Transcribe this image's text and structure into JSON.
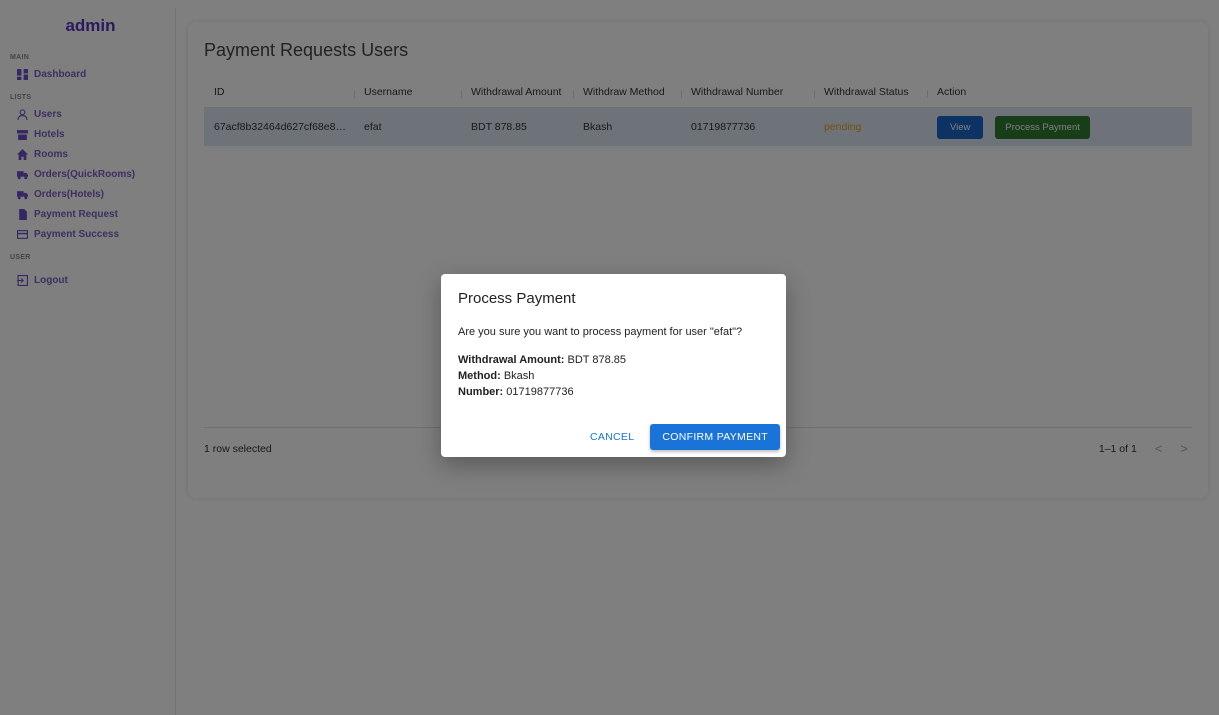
{
  "sidebar": {
    "brand": "admin",
    "sections": {
      "main": "MAIN",
      "lists": "LISTS",
      "user": "USER"
    },
    "items": {
      "dashboard": "Dashboard",
      "users": "Users",
      "hotels": "Hotels",
      "rooms": "Rooms",
      "orders_quickrooms": "Orders(QuickRooms)",
      "orders_hotels": "Orders(Hotels)",
      "payment_request": "Payment Request",
      "payment_success": "Payment Success",
      "logout": "Logout"
    }
  },
  "main": {
    "title": "Payment Requests Users",
    "columns": [
      "ID",
      "Username",
      "Withdrawal Amount",
      "Withdraw Method",
      "Withdrawal Number",
      "Withdrawal Status",
      "Action",
      ""
    ],
    "rows": [
      {
        "id": "67acf8b32464d627cf68e8…",
        "username": "efat",
        "amount": "BDT 878.85",
        "method": "Bkash",
        "number": "01719877736",
        "status": "pending",
        "view_label": "View",
        "process_label": "Process Payment"
      }
    ],
    "footer": {
      "selected": "1 row selected",
      "range": "1–1 of 1",
      "prev": "<",
      "next": ">"
    }
  },
  "dialog": {
    "title": "Process Payment",
    "message": "Are you sure you want to process payment for user \"efat\"?",
    "amount_label": "Withdrawal Amount:",
    "amount_value": "BDT 878.85",
    "method_label": "Method:",
    "method_value": "Bkash",
    "number_label": "Number:",
    "number_value": "01719877736",
    "cancel_label": "CANCEL",
    "confirm_label": "CONFIRM PAYMENT"
  },
  "colors": {
    "brand": "#5a35b8",
    "primary": "#1a73d8",
    "success": "#2e7d32",
    "pending": "#e6a21a",
    "selected_row": "#dce6f2"
  }
}
